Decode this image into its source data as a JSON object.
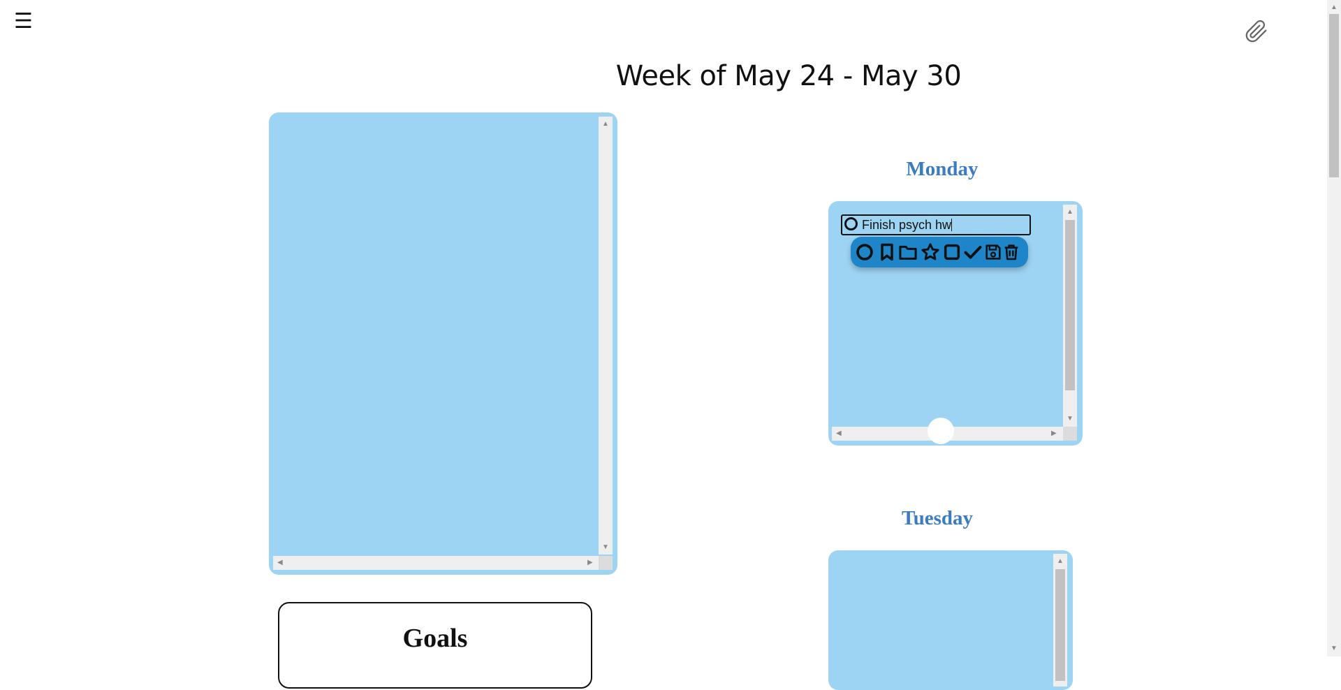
{
  "header": {
    "menu_icon": "☰",
    "page_title": "Week of May 24 - May 30"
  },
  "days": {
    "monday": {
      "title": "Monday",
      "task_text": "Finish psych hw"
    },
    "tuesday": {
      "title": "Tuesday"
    }
  },
  "toolbar": {
    "icons": [
      "circle-icon",
      "bookmark-icon",
      "folder-icon",
      "star-icon",
      "square-icon",
      "check-icon",
      "save-icon",
      "trash-icon"
    ]
  },
  "goals": {
    "title": "Goals"
  },
  "colors": {
    "panel": "#9dd4f3",
    "toolbar": "#1e86c8",
    "day_title": "#3a7cc2"
  }
}
